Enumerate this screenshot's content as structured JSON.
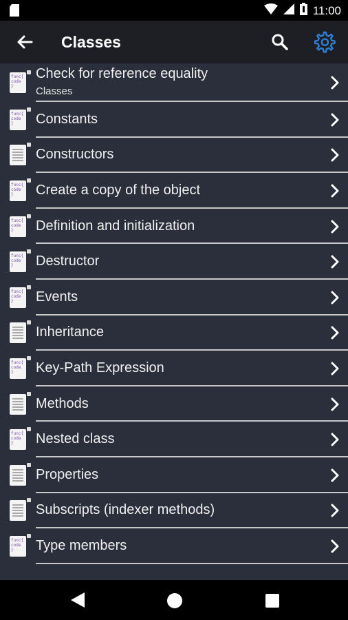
{
  "status_bar": {
    "time": "11:00"
  },
  "toolbar": {
    "title": "Classes",
    "accent": "#2f7fd6"
  },
  "items": [
    {
      "label": "Check for reference equality",
      "sublabel": "Classes",
      "icon": "code-doc-icon"
    },
    {
      "label": "Constants",
      "icon": "code-doc-icon"
    },
    {
      "label": "Constructors",
      "icon": "text-doc-icon"
    },
    {
      "label": "Create a copy of the object",
      "icon": "code-doc-icon"
    },
    {
      "label": "Definition and initialization",
      "icon": "code-doc-icon"
    },
    {
      "label": "Destructor",
      "icon": "code-doc-icon"
    },
    {
      "label": "Events",
      "icon": "code-doc-icon"
    },
    {
      "label": "Inheritance",
      "icon": "text-doc-icon"
    },
    {
      "label": "Key-Path Expression",
      "icon": "code-doc-icon"
    },
    {
      "label": "Methods",
      "icon": "text-doc-icon"
    },
    {
      "label": "Nested class",
      "icon": "code-doc-icon"
    },
    {
      "label": "Properties",
      "icon": "text-doc-icon"
    },
    {
      "label": "Subscripts (indexer methods)",
      "icon": "text-doc-icon"
    },
    {
      "label": "Type members",
      "icon": "code-doc-icon"
    }
  ],
  "code_icon_text": [
    "func{",
    "code",
    "}"
  ]
}
